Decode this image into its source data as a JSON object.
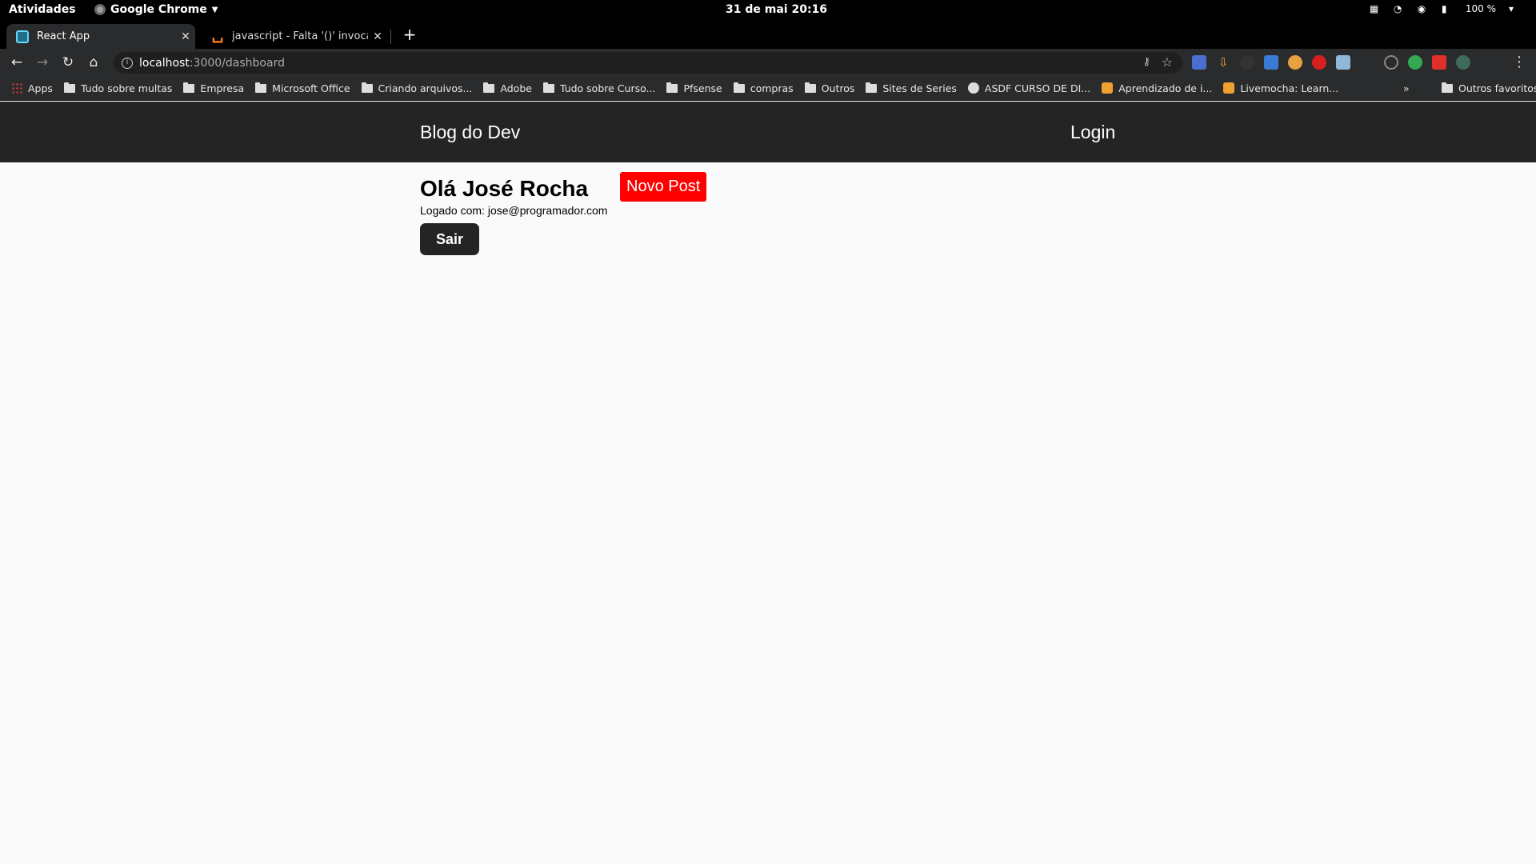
{
  "os": {
    "activities": "Atividades",
    "app_name": "Google Chrome",
    "clock": "31 de mai  20:16",
    "battery": "100 %"
  },
  "browser": {
    "tabs": [
      {
        "title": "React App",
        "icon": "react-favicon",
        "active": true
      },
      {
        "title": "javascript - Falta '()' invocand",
        "icon": "stackoverflow-favicon",
        "active": false
      }
    ],
    "url_host": "localhost",
    "url_rest": ":3000/dashboard",
    "bookmarks": [
      {
        "label": "Apps",
        "icon": "apps-grid-icon"
      },
      {
        "label": "Tudo sobre multas",
        "icon": "folder-icon"
      },
      {
        "label": "Empresa",
        "icon": "folder-icon"
      },
      {
        "label": "Microsoft Office",
        "icon": "folder-icon"
      },
      {
        "label": "Criando arquivos...",
        "icon": "folder-icon"
      },
      {
        "label": "Adobe",
        "icon": "folder-icon"
      },
      {
        "label": "Tudo sobre Curso...",
        "icon": "folder-icon"
      },
      {
        "label": "Pfsense",
        "icon": "folder-icon"
      },
      {
        "label": "compras",
        "icon": "folder-icon"
      },
      {
        "label": "Outros",
        "icon": "folder-icon"
      },
      {
        "label": "Sites de Series",
        "icon": "folder-icon"
      },
      {
        "label": "ASDF CURSO DE DI...",
        "icon": "globe-icon"
      },
      {
        "label": "Aprendizado de i...",
        "icon": "livemocha-icon"
      },
      {
        "label": "Livemocha: Learn...",
        "icon": "livemocha-icon"
      }
    ],
    "bookmarks_overflow": "»",
    "other_bookmarks": "Outros favoritos"
  },
  "site": {
    "brand": "Blog do Dev",
    "login": "Login",
    "greeting": "Olá José Rocha",
    "logged_as": "Logado com: jose@programador.com",
    "new_post": "Novo Post",
    "logout": "Sair",
    "colors": {
      "header_bg": "#242424",
      "new_post_bg": "#ff0000",
      "page_bg": "#fafafa"
    }
  }
}
